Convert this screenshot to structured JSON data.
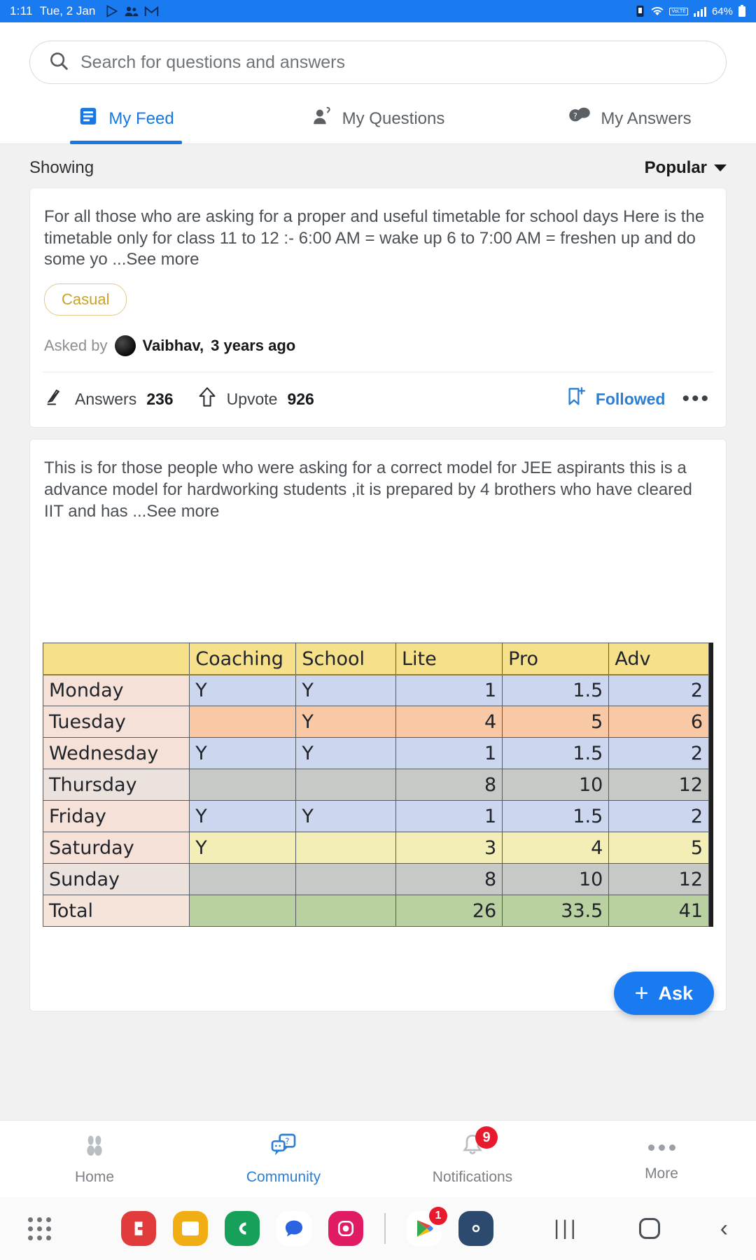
{
  "statusbar": {
    "time": "1:11",
    "date": "Tue, 2 Jan",
    "battery": "64%",
    "icons": [
      "play-triangle-icon",
      "contacts-icon",
      "gmail-icon"
    ],
    "right_icons": [
      "alarm-icon",
      "wifi-icon",
      "volte-icon",
      "signal-icon",
      "battery-icon"
    ],
    "volte_label": "VoLTE"
  },
  "search": {
    "placeholder": "Search for questions and answers",
    "icon": "search-icon"
  },
  "tabs": [
    {
      "label": "My Feed",
      "icon": "feed-icon",
      "active": true
    },
    {
      "label": "My Questions",
      "icon": "person-question-icon",
      "active": false
    },
    {
      "label": "My Answers",
      "icon": "answer-bubble-icon",
      "active": false
    }
  ],
  "showing": {
    "label": "Showing",
    "sort_value": "Popular",
    "caret": "chevron-down-icon"
  },
  "posts": [
    {
      "body": "For all those who are asking for a proper and useful timetable for school days Here is the timetable only for class 11 to 12 :- 6:00 AM = wake up 6 to 7:00 AM = freshen up and do some yo",
      "see_more": "...See more",
      "tag": "Casual",
      "asked_by_label": "Asked by",
      "author": "Vaibhav,",
      "time_ago": "3 years ago",
      "answers_label": "Answers",
      "answers_count": "236",
      "upvote_label": "Upvote",
      "upvote_count": "926",
      "follow_label": "Followed",
      "more_icon": "overflow-menu-icon",
      "answers_icon": "pencil-icon",
      "upvote_icon": "upvote-arrow-icon",
      "follow_icon": "bookmark-plus-icon"
    },
    {
      "body": "This is for those people who were asking for a correct model for JEE aspirants this is a advance model for hardworking students ,it is prepared by 4 brothers who have cleared IIT and has",
      "see_more": "...See more"
    }
  ],
  "chart_data": {
    "type": "table",
    "title": "",
    "columns": [
      "",
      "Coaching",
      "School",
      "Lite",
      "Pro",
      "Adv"
    ],
    "rows": [
      {
        "day": "Monday",
        "coaching": "Y",
        "school": "Y",
        "lite": "1",
        "pro": "1.5",
        "adv": "2",
        "color": "blue"
      },
      {
        "day": "Tuesday",
        "coaching": "",
        "school": "Y",
        "lite": "4",
        "pro": "5",
        "adv": "6",
        "color": "orange"
      },
      {
        "day": "Wednesday",
        "coaching": "Y",
        "school": "Y",
        "lite": "1",
        "pro": "1.5",
        "adv": "2",
        "color": "blue"
      },
      {
        "day": "Thursday",
        "coaching": "",
        "school": "",
        "lite": "8",
        "pro": "10",
        "adv": "12",
        "color": "grey"
      },
      {
        "day": "Friday",
        "coaching": "Y",
        "school": "Y",
        "lite": "1",
        "pro": "1.5",
        "adv": "2",
        "color": "blue"
      },
      {
        "day": "Saturday",
        "coaching": "Y",
        "school": "",
        "lite": "3",
        "pro": "4",
        "adv": "5",
        "color": "yellow"
      },
      {
        "day": "Sunday",
        "coaching": "",
        "school": "",
        "lite": "8",
        "pro": "10",
        "adv": "12",
        "color": "grey"
      },
      {
        "day": "Total",
        "coaching": "",
        "school": "",
        "lite": "26",
        "pro": "33.5",
        "adv": "41",
        "color": "green"
      }
    ]
  },
  "fab": {
    "label": "Ask",
    "plus": "+"
  },
  "bottomnav": [
    {
      "label": "Home",
      "icon": "home-footprint-icon",
      "active": false,
      "badge": ""
    },
    {
      "label": "Community",
      "icon": "community-chat-icon",
      "active": true,
      "badge": ""
    },
    {
      "label": "Notifications",
      "icon": "bell-icon",
      "active": false,
      "badge": "9"
    },
    {
      "label": "More",
      "icon": "more-dots-icon",
      "active": false,
      "badge": ""
    }
  ],
  "dock": {
    "drawer_icon": "app-drawer-icon",
    "apps": [
      "red-app-icon",
      "yellow-files-icon",
      "green-phone-icon",
      "blue-messages-icon",
      "pink-camera-icon",
      "play-store-icon",
      "settings-gear-icon"
    ],
    "play_store_badge": "1",
    "nav_keys": [
      "recents-key",
      "home-key",
      "back-key"
    ]
  },
  "colors": {
    "accent": "#1a7bf0",
    "status_bar": "#1a7bf0",
    "tag": "#c9a227",
    "badge": "#e8192c"
  }
}
